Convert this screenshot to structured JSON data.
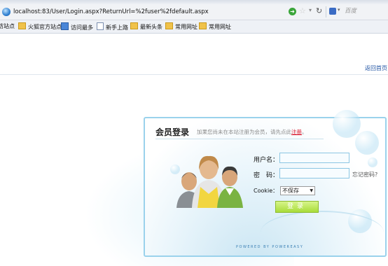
{
  "browser": {
    "url": "localhost:83/User/Login.aspx?ReturnUrl=%2fuser%2fdefault.aspx",
    "search_placeholder": "百度",
    "bookmarks": [
      "访站点",
      "火狐官方站点",
      "访问最多",
      "新手上路",
      "最新头条",
      "常用网址",
      "常用网址"
    ]
  },
  "page": {
    "back_home": "返回首页"
  },
  "login": {
    "title": "会员登录",
    "subtitle_prefix": "加果您尚未在本站注册为会员，请先点此",
    "register_link": "注册",
    "subtitle_suffix": "。",
    "username_label": "用户名：",
    "username_value": "",
    "password_label": "密　码：",
    "password_value": "",
    "forgot_password": "忘记密码?",
    "cookie_label": "Cookie：",
    "cookie_value": "不保存",
    "login_button": "登录",
    "powered_by": "POWERED BY POWEREASY"
  },
  "colors": {
    "panel_border": "#9ad2ec",
    "button": "#a8dc3a",
    "register_link": "#d8162b"
  }
}
